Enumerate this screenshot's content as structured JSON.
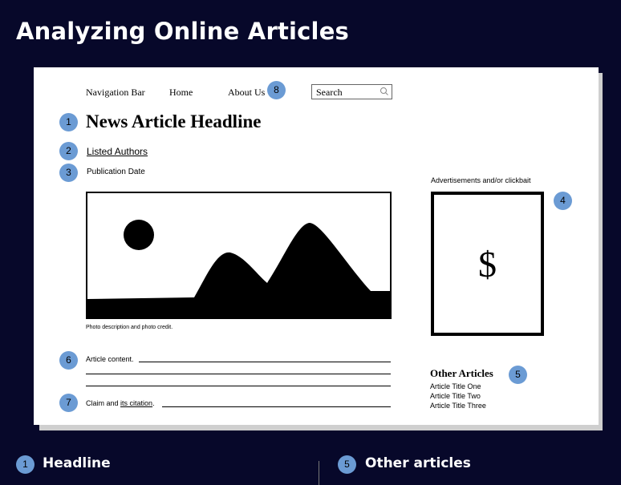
{
  "title": "Analyzing Online Articles",
  "nav": {
    "items": [
      "Navigation Bar",
      "Home",
      "About Us"
    ],
    "search_label": "Search"
  },
  "article": {
    "headline": "News Article Headline",
    "authors": "Listed Authors",
    "publication_date": "Publication Date",
    "photo_caption": "Photo description and photo credit.",
    "content_label": "Article content.",
    "claim_label": "Claim and ",
    "claim_link": "its citation",
    "claim_period": "."
  },
  "ads": {
    "label": "Advertisements and/or clickbait",
    "symbol": "$"
  },
  "other_articles": {
    "heading": "Other Articles",
    "items": [
      "Article Title One",
      "Article Title Two",
      "Article Title Three"
    ]
  },
  "badges": [
    "1",
    "2",
    "3",
    "4",
    "5",
    "6",
    "7",
    "8"
  ],
  "sections": [
    {
      "number": "1",
      "title": "Headline"
    },
    {
      "number": "5",
      "title": "Other articles"
    }
  ],
  "colors": {
    "background": "#07082a",
    "badge": "#6b9bd4",
    "page": "#ffffff"
  }
}
